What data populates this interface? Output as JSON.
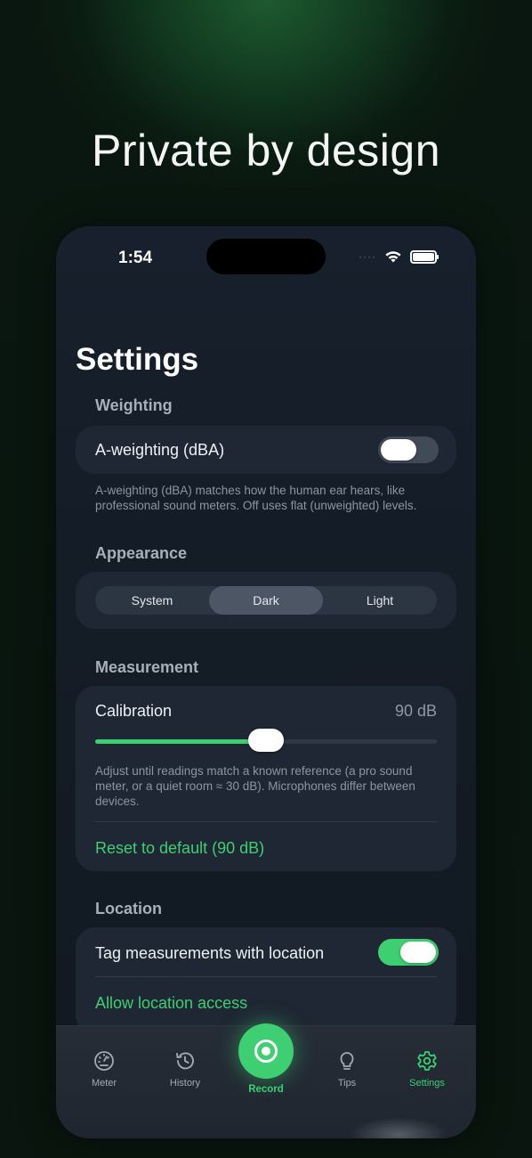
{
  "headline": "Private by design",
  "status_bar": {
    "time": "1:54",
    "dots": "····"
  },
  "settings": {
    "title": "Settings",
    "weighting": {
      "section": "Weighting",
      "toggle_label": "A-weighting (dBA)",
      "toggle_on": false,
      "footnote": "A-weighting (dBA) matches how the human ear hears, like professional sound meters. Off uses flat (unweighted) levels."
    },
    "appearance": {
      "section": "Appearance",
      "options": [
        "System",
        "Dark",
        "Light"
      ],
      "selected": "Dark"
    },
    "measurement": {
      "section": "Measurement",
      "calibration_label": "Calibration",
      "calibration_value": "90 dB",
      "slider_level": 0.5,
      "footnote": "Adjust until readings match a known reference (a pro sound meter, or a quiet room ≈ 30 dB). Microphones differ between devices.",
      "reset_label": "Reset to default (90 dB)"
    },
    "location": {
      "section": "Location",
      "toggle_label": "Tag measurements with location",
      "toggle_on": true,
      "access_label": "Allow location access"
    }
  },
  "tabbar": {
    "tabs": [
      {
        "label": "Meter",
        "icon": "gauge-icon"
      },
      {
        "label": "History",
        "icon": "history-icon"
      },
      {
        "label": "Record",
        "icon": "record-icon"
      },
      {
        "label": "Tips",
        "icon": "lightbulb-icon"
      },
      {
        "label": "Settings",
        "icon": "gear-icon"
      }
    ],
    "active": "Settings"
  },
  "colors": {
    "accent": "#3ecf72",
    "card": "#1e2733",
    "background": "#0b1d12"
  }
}
